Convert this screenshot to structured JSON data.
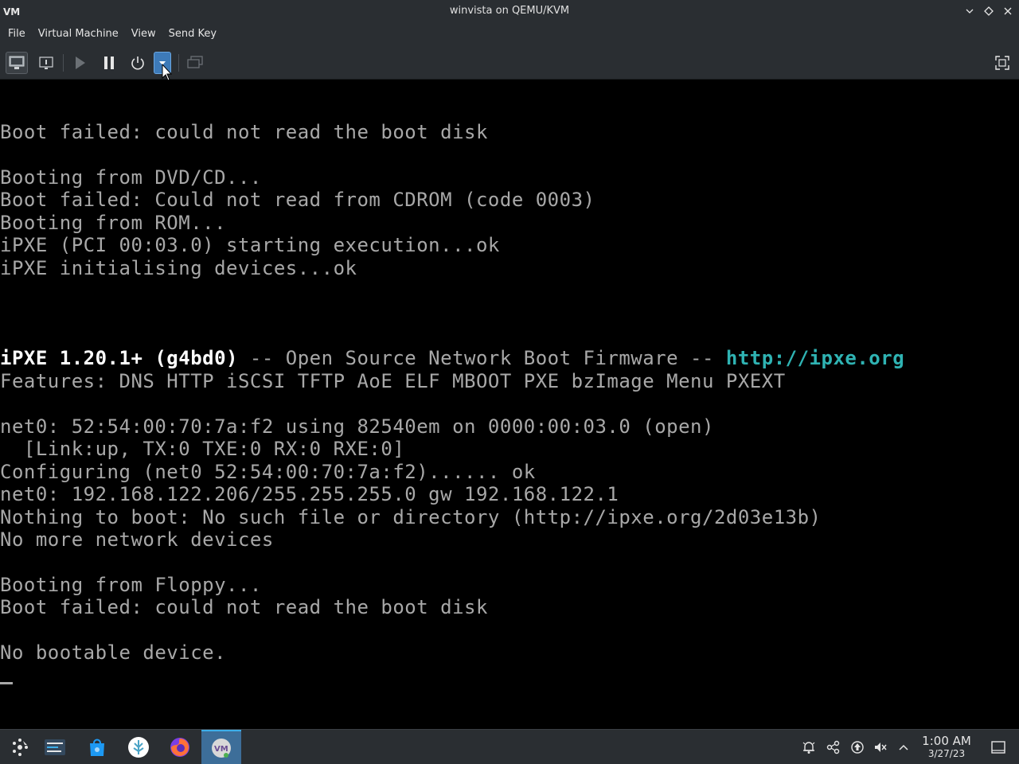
{
  "window": {
    "title": "winvista on QEMU/KVM",
    "app_icon": "virt-manager-logo"
  },
  "menu": {
    "items": [
      "File",
      "Virtual Machine",
      "View",
      "Send Key"
    ]
  },
  "toolbar": {
    "buttons": [
      "show-console-icon",
      "details-icon",
      "run-icon",
      "pause-icon",
      "shutdown-icon",
      "shutdown-menu-dropdown-icon",
      "snapshots-icon",
      "fullscreen-icon"
    ]
  },
  "console": {
    "lines": [
      "Boot failed: could not read the boot disk",
      "",
      "Booting from DVD/CD...",
      "Boot failed: Could not read from CDROM (code 0003)",
      "Booting from ROM...",
      "iPXE (PCI 00:03.0) starting execution...ok",
      "iPXE initialising devices...ok",
      "",
      "",
      "",
      "",
      "Features: DNS HTTP iSCSI TFTP AoE ELF MBOOT PXE bzImage Menu PXEXT",
      "",
      "net0: 52:54:00:70:7a:f2 using 82540em on 0000:00:03.0 (open)",
      "  [Link:up, TX:0 TXE:0 RX:0 RXE:0]",
      "Configuring (net0 52:54:00:70:7a:f2)...... ok",
      "net0: 192.168.122.206/255.255.255.0 gw 192.168.122.1",
      "Nothing to boot: No such file or directory (http://ipxe.org/2d03e13b)",
      "No more network devices",
      "",
      "Booting from Floppy...",
      "Boot failed: could not read the boot disk",
      "",
      "No bootable device."
    ],
    "ipxe_banner": {
      "name": "iPXE 1.20.1+ (g4bd0)",
      "middle": " -- Open Source Network Boot Firmware -- ",
      "url": "http://ipxe.org"
    },
    "colors": {
      "text": "#a8a8a8",
      "bright": "#ffffff",
      "link": "#2fb3b3"
    }
  },
  "taskbar": {
    "apps": [
      "application-launcher-icon",
      "task-switcher-icon",
      "discover-store-icon",
      "krita-like-icon",
      "firefox-icon",
      "virt-manager-icon"
    ],
    "tray": [
      "notifications-icon",
      "kde-connect-icon",
      "updates-icon",
      "volume-muted-icon",
      "expand-tray-icon"
    ],
    "clock": {
      "time": "1:00 AM",
      "date": "3/27/23"
    }
  }
}
